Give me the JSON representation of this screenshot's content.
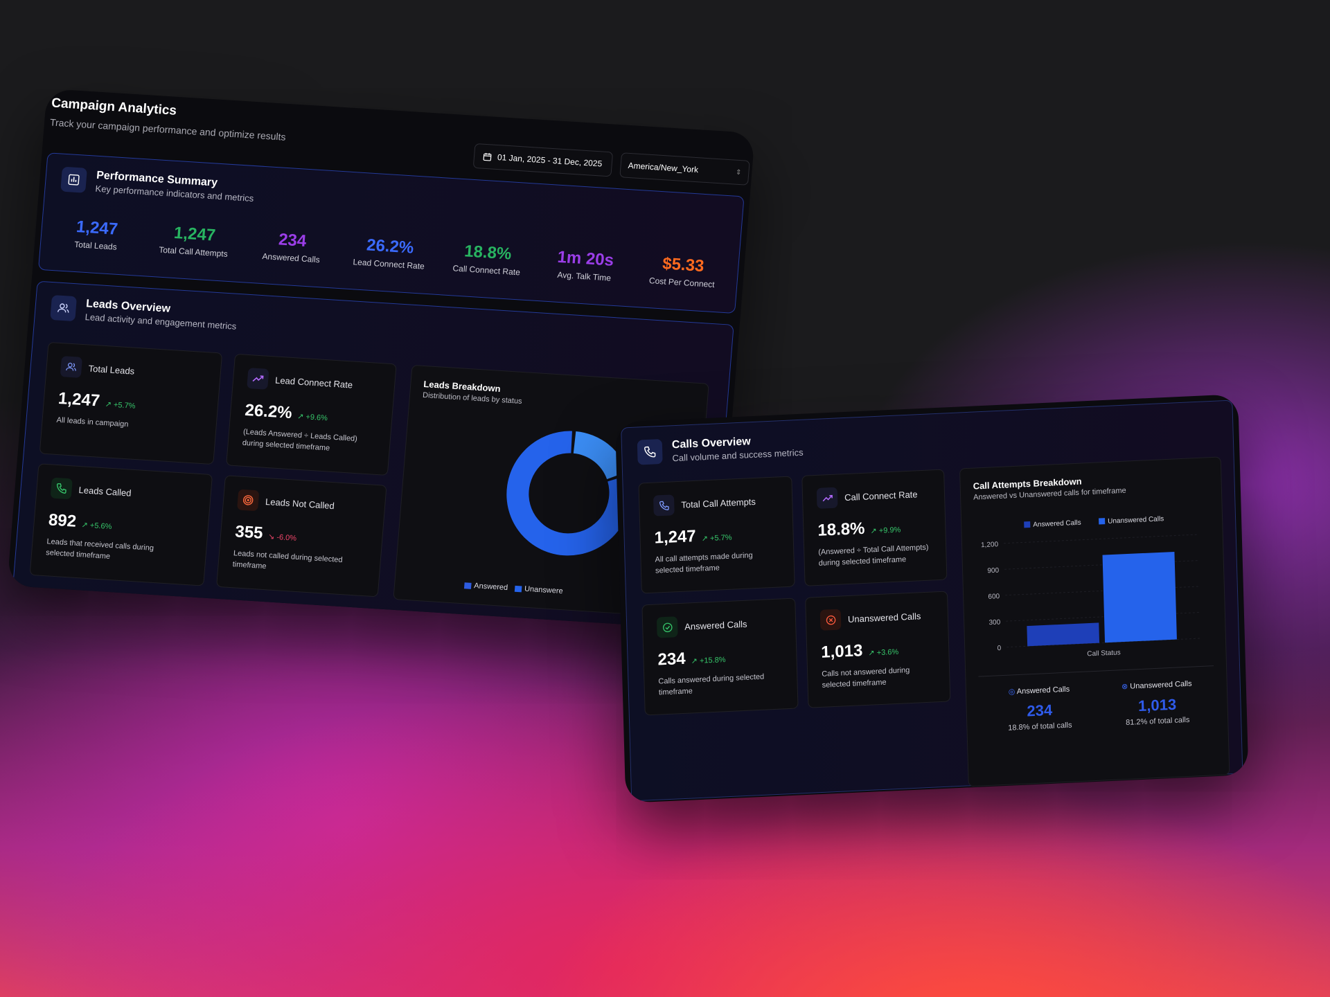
{
  "app": {
    "title": "Campaign Analytics",
    "subtitle": "Track your campaign performance and optimize results",
    "date_range": "01 Jan, 2025 - 31 Dec, 2025",
    "timezone": "America/New_York"
  },
  "performance": {
    "title": "Performance Summary",
    "subtitle": "Key performance indicators and metrics",
    "kpis": [
      {
        "value": "1,247",
        "label": "Total Leads",
        "color": "#3b6bff"
      },
      {
        "value": "1,247",
        "label": "Total Call Attempts",
        "color": "#28b461"
      },
      {
        "value": "234",
        "label": "Answered Calls",
        "color": "#9b3ee8"
      },
      {
        "value": "26.2%",
        "label": "Lead Connect Rate",
        "color": "#3b6bff"
      },
      {
        "value": "18.8%",
        "label": "Call Connect Rate",
        "color": "#28b461"
      },
      {
        "value": "1m 20s",
        "label": "Avg. Talk Time",
        "color": "#9b3ee8"
      },
      {
        "value": "$5.33",
        "label": "Cost Per Connect",
        "color": "#ff6b1f"
      }
    ]
  },
  "leads": {
    "title": "Leads Overview",
    "subtitle": "Lead activity and engagement metrics",
    "cards": [
      {
        "title": "Total Leads",
        "value": "1,247",
        "delta": "+5.7%",
        "desc": "All leads in campaign",
        "icon": "users-icon"
      },
      {
        "title": "Lead Connect Rate",
        "value": "26.2%",
        "delta": "+9.6%",
        "desc": "(Leads Answered ÷ Leads Called) during selected timeframe",
        "icon": "trend-up-icon"
      },
      {
        "title": "Leads Called",
        "value": "892",
        "delta": "+5.6%",
        "desc": "Leads that received calls during selected timeframe",
        "icon": "phone-icon"
      },
      {
        "title": "Leads Not Called",
        "value": "355",
        "delta": "-6.0%",
        "desc": "Leads not called during selected timeframe",
        "icon": "target-icon"
      }
    ],
    "breakdown": {
      "title": "Leads Breakdown",
      "subtitle": "Distribution of leads by status",
      "legend": [
        "Answered",
        "Unanswere"
      ]
    }
  },
  "calls": {
    "title": "Calls Overview",
    "subtitle": "Call volume and success metrics",
    "cards": [
      {
        "title": "Total Call Attempts",
        "value": "1,247",
        "delta": "+5.7%",
        "desc": "All call attempts made during selected timeframe",
        "icon": "phone-icon"
      },
      {
        "title": "Call Connect Rate",
        "value": "18.8%",
        "delta": "+9.9%",
        "desc": "(Answered ÷ Total Call Attempts) during selected timeframe",
        "icon": "trend-up-icon"
      },
      {
        "title": "Answered Calls",
        "value": "234",
        "delta": "+15.8%",
        "desc": "Calls answered during selected timeframe",
        "icon": "check-circle-icon"
      },
      {
        "title": "Unanswered Calls",
        "value": "1,013",
        "delta": "+3.6%",
        "desc": "Calls not answered during selected timeframe",
        "icon": "x-circle-icon"
      }
    ],
    "breakdown": {
      "title": "Call Attempts Breakdown",
      "subtitle": "Answered vs Unanswered calls for timeframe",
      "summary": [
        {
          "label": "Answered Calls",
          "value": "234",
          "pct": "18.8% of total calls"
        },
        {
          "label": "Unanswered Calls",
          "value": "1,013",
          "pct": "81.2% of total calls"
        }
      ]
    }
  },
  "chart_data": [
    {
      "type": "pie",
      "title": "Leads Breakdown",
      "subtitle": "Distribution of leads by status",
      "series": [
        {
          "name": "Answered",
          "value": 234,
          "color": "#3b8df5"
        },
        {
          "name": "Unanswered",
          "value": 1013,
          "color": "#2563eb"
        }
      ]
    },
    {
      "type": "bar",
      "title": "Call Attempts Breakdown",
      "subtitle": "Answered vs Unanswered calls for timeframe",
      "xlabel": "Call Status",
      "ylabel": "",
      "ylim": [
        0,
        1200
      ],
      "yticks": [
        0,
        300,
        600,
        900,
        "1,200"
      ],
      "legend_position": "top",
      "grid": true,
      "series": [
        {
          "name": "Answered Calls",
          "values": [
            234
          ],
          "color": "#1e3fb8"
        },
        {
          "name": "Unanswered Calls",
          "values": [
            1013
          ],
          "color": "#2563eb"
        }
      ]
    }
  ]
}
